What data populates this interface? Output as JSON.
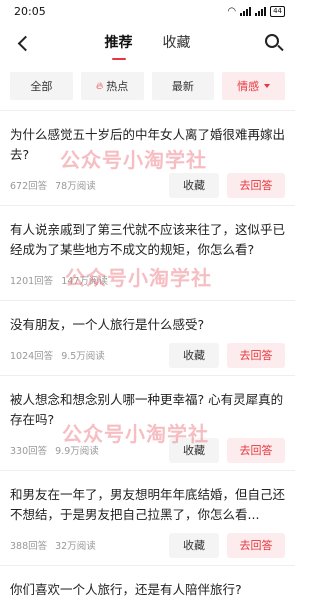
{
  "status_bar": {
    "time": "20:05",
    "battery": "44"
  },
  "header": {
    "tabs": [
      {
        "label": "推荐",
        "active": true
      },
      {
        "label": "收藏",
        "active": false
      }
    ]
  },
  "filters": [
    {
      "label": "全部"
    },
    {
      "label": "热点",
      "icon": "fire-icon"
    },
    {
      "label": "最新"
    },
    {
      "label": "情感",
      "active": true,
      "icon": "caret-down-icon"
    }
  ],
  "questions": [
    {
      "title": "为什么感觉五十岁后的中年女人离了婚很难再嫁出去?",
      "answers": "672回答",
      "views": "78万阅读"
    },
    {
      "title": "有人说亲戚到了第三代就不应该来往了，这似乎已经成为了某些地方不成文的规矩，你怎么看?",
      "answers": "1201回答",
      "views": "147万阅读"
    },
    {
      "title": "没有朋友，一个人旅行是什么感受?",
      "answers": "1024回答",
      "views": "9.5万阅读"
    },
    {
      "title": "被人想念和想念别人哪一种更幸福? 心有灵犀真的存在吗?",
      "answers": "330回答",
      "views": "9.9万阅读"
    },
    {
      "title": "和男友在一年了，男友想明年年底结婚，但自己还不想结，于是男友把自己拉黑了，你怎么看...",
      "answers": "388回答",
      "views": "32万阅读"
    },
    {
      "title": "你们喜欢一个人旅行，还是有人陪伴旅行?",
      "answers": "",
      "views": ""
    }
  ],
  "actions": {
    "favorite": "收藏",
    "answer": "去回答"
  },
  "watermark": "公众号小淘学社",
  "colors": {
    "accent": "#e5373d",
    "accent_bg": "#fdeced",
    "chip_bg": "#f4f4f4"
  }
}
